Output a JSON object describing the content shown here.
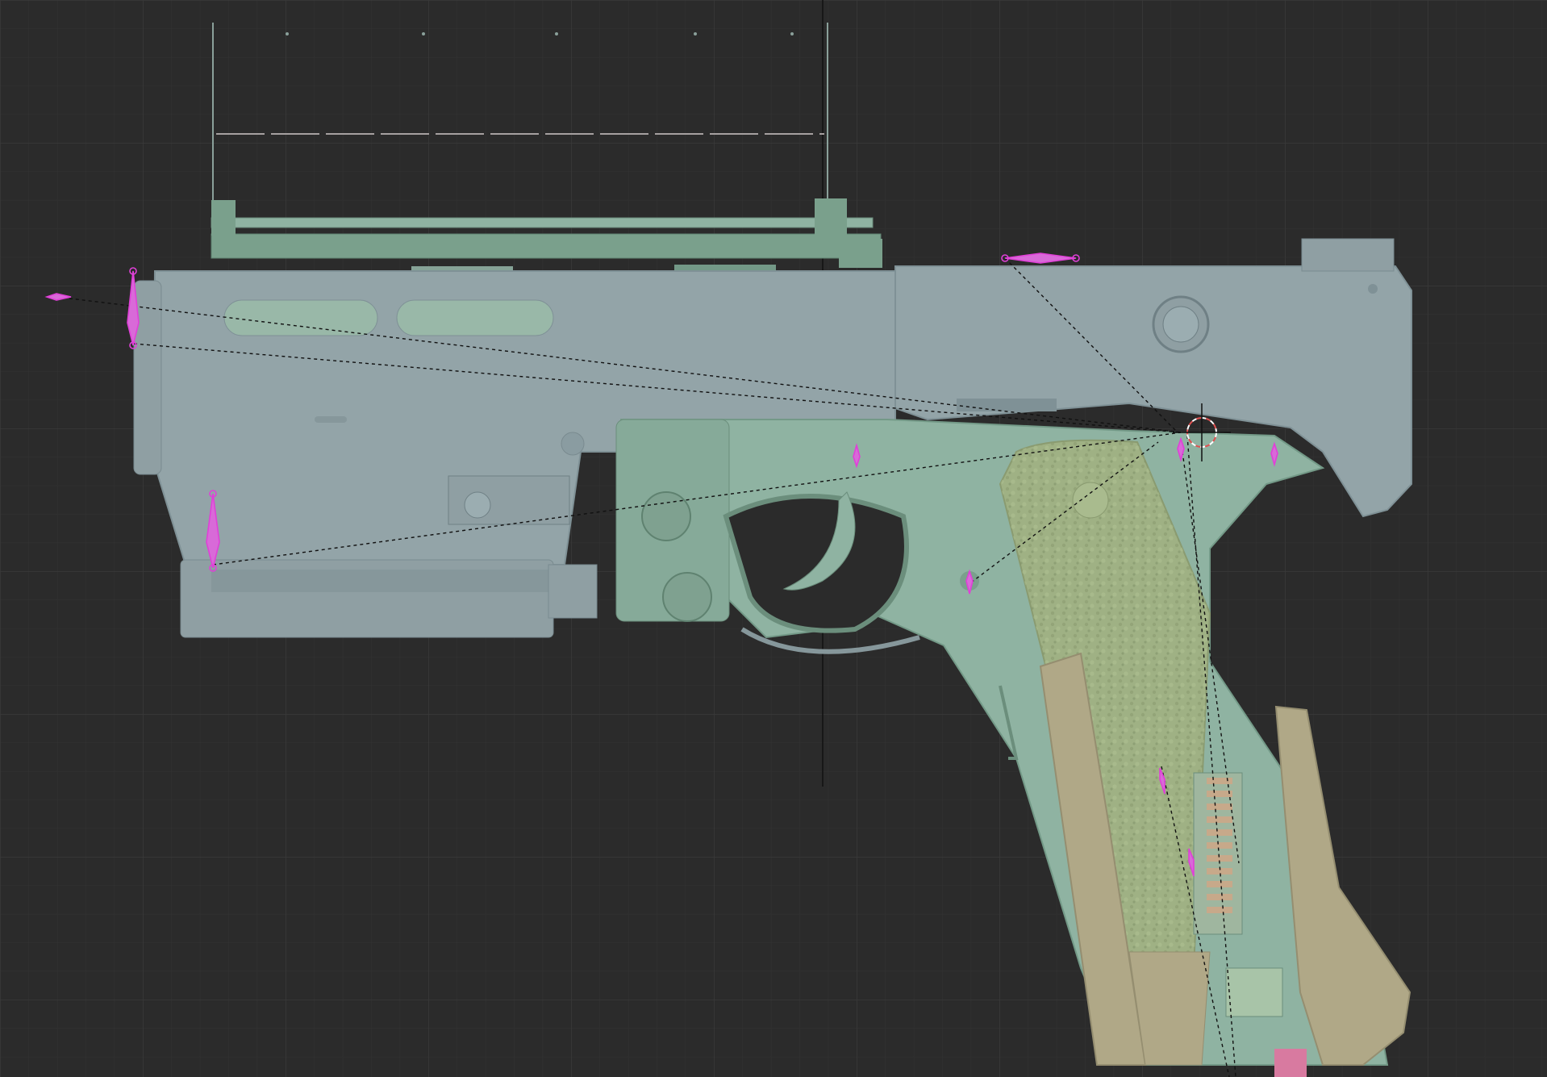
{
  "viewport": {
    "background": "#2b2b2b",
    "grid_minor_color": "#333333",
    "grid_major_color": "#3a3a3a"
  },
  "colors": {
    "slide": "#93a4a8",
    "slide_dark": "#7f9196",
    "frame": "#8fb3a2",
    "frame_dark": "#739987",
    "grip": "#9fb184",
    "grip_dark": "#8a9b70",
    "tan": "#b0a887",
    "tan_dark": "#958e70",
    "bone": "#e040d8",
    "relation_line": "#111111",
    "cursor_ring": "#e05050"
  },
  "bones": {
    "count": 10,
    "icon": "armature-bone-icon"
  },
  "object": {
    "icon": "pistol-mesh-icon"
  }
}
